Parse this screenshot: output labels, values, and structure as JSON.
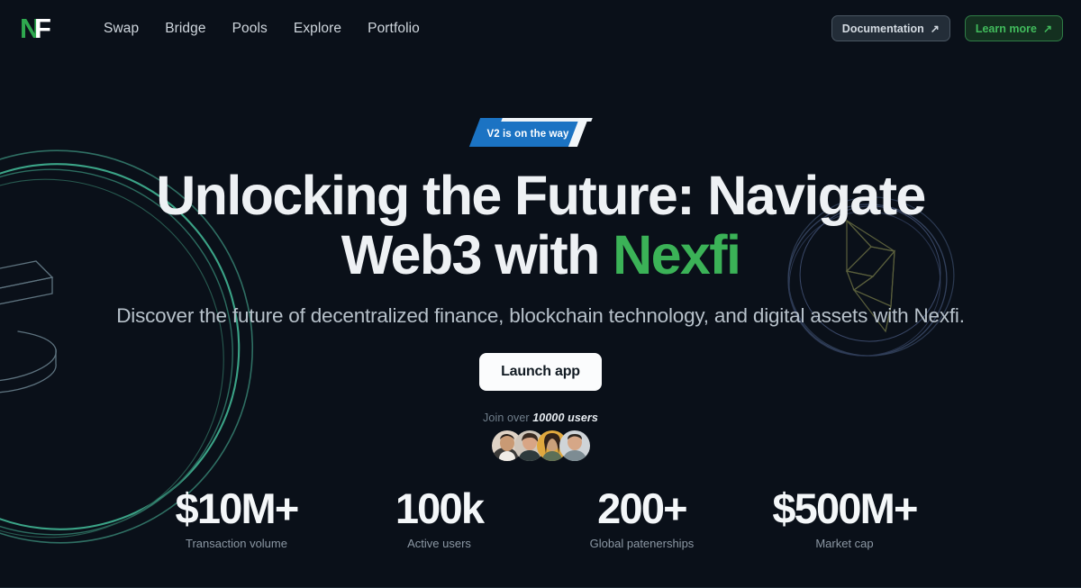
{
  "brand": {
    "logo_primary": "N",
    "logo_secondary": "F",
    "name": "Nexfi",
    "green": "#3bb257",
    "background": "#0a1019"
  },
  "nav": {
    "links": [
      {
        "label": "Swap"
      },
      {
        "label": "Bridge"
      },
      {
        "label": "Pools"
      },
      {
        "label": "Explore"
      },
      {
        "label": "Portfolio"
      }
    ],
    "documentation_button": {
      "label": "Documentation",
      "icon": "arrow-up-right-icon",
      "glyph": "↗"
    },
    "learn_more_button": {
      "label": "Learn more",
      "icon": "arrow-up-right-icon",
      "glyph": "↗",
      "color": "#41bb5c"
    }
  },
  "hero": {
    "badge": {
      "label": "V2 is on the way",
      "color": "#1b73c3"
    },
    "headline_part1": "Unlocking the Future: Navigate",
    "headline_part2": "Web3 with ",
    "headline_accent": "Nexfi",
    "subheadline": "Discover the future of decentralized finance, blockchain technology, and digital assets with Nexfi.",
    "cta_button": {
      "label": "Launch app"
    },
    "social_proof": {
      "prefix": "Join over",
      "count_text": "10000 users",
      "avatar_count": 4
    }
  },
  "stats": [
    {
      "value": "$10M+",
      "label": "Transaction volume"
    },
    {
      "value": "100k",
      "label": "Active users"
    },
    {
      "value": "200+",
      "label": "Global patenerships"
    },
    {
      "value": "$500M+",
      "label": "Market cap"
    }
  ],
  "decorations": {
    "left_coin": "usdt-tether-coin-outline",
    "right_coin": "ethereum-coin-outline"
  }
}
